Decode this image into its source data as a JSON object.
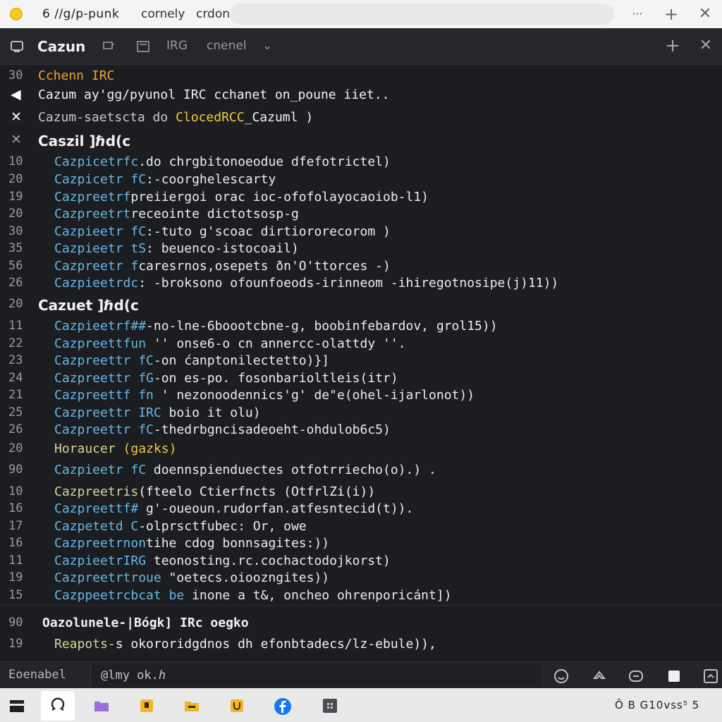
{
  "titlebar": {
    "title": "6 //g/p-punk",
    "tab1": "cornely",
    "tab2": "crdon",
    "more": "···",
    "plus": "+",
    "close": "✕"
  },
  "channel": {
    "title": "Cazun",
    "tab_label": "IRG",
    "tab_label2": "cnenel",
    "chevron": "⌄",
    "plus": "+",
    "close": "✕"
  },
  "log": {
    "rows": [
      {
        "num": "30",
        "text": "Cchenn IRC"
      },
      {
        "icon": "◀",
        "text": "Cazum ay'gg/pyunol IRC cchanet on_poune iiet.."
      },
      {
        "icon": "✕",
        "text_a": "Cazum-saetscta do ",
        "text_b": "ClocedRCC",
        "text_c": "_Cazuml )"
      },
      {
        "icon": "✕",
        "text": "Caszil ]ℏd(c"
      },
      {
        "num": "10",
        "nick": "Cazpicetrfc",
        "msg": ".do chrgbitonoeodue dfefotrictel)"
      },
      {
        "num": "20",
        "nick": "Cazpicetr fC",
        "msg": ":-coorghelescarty"
      },
      {
        "num": "19",
        "nick": "Cazpreetrf",
        "msg": "preiiergoi orac ioc-ofofolayocaoiob-l1)"
      },
      {
        "num": "20",
        "nick": "Cazpreetrt",
        "msg": "receointe dictotsosp-g"
      },
      {
        "num": "30",
        "nick": "Cazpieetr fC",
        "msg": ":-tuto g'scoac dirtiororecorom  )"
      },
      {
        "num": "35",
        "nick": "Cazpieetr tS",
        "msg": ": beuenco-istocoail)"
      },
      {
        "num": "56",
        "nick": "Cazpreetr f",
        "msg": "caresrnos,osepets ðn'O'ttorces -)"
      },
      {
        "num": "26",
        "nick": "Cazpieetrdc",
        "msg": ": -broksono ofounfoeods-irinneom -ihiregotnosipe(j)11))"
      },
      {
        "num": "20",
        "text": "Cazuet ]ℏd(c"
      },
      {
        "num": "11",
        "nick": "Cazpieetrf##",
        "msg": "-no-lne-6boootcbne-g, boobinfebardov, grol15))"
      },
      {
        "num": "22",
        "nick": "Cazpreettfun",
        "msg": " '' onse6-o cn annercc-olattdy  ''."
      },
      {
        "num": "23",
        "nick": "Cazpreettr fC",
        "msg": "-on ćanptonilectetto)}]"
      },
      {
        "num": "24",
        "nick": "Cazpreettr fG",
        "msg": "-on es-po. fosonbarioltleis(itr)"
      },
      {
        "num": "21",
        "nick": "Cazpreettf fn",
        "msg": " ' nezonoodennics'g' de\"e(ohel-ijarlonot))"
      },
      {
        "num": "25",
        "nick": "Cazpreettr IRC",
        "msg": " boio it olu)"
      },
      {
        "num": "26",
        "nick": "Cazpreettr fC",
        "msg": "-thedrbgncisadeoeht-ohdulob6c5)"
      },
      {
        "num": "20",
        "text_a": "Horаucer ",
        "text_b": "(gazks)"
      },
      {
        "num": "90",
        "nick": "Cazpieetr fC",
        "msg": " doennspienduectes otfotrriecho(o).)  ."
      },
      {
        "num": "10",
        "text_a": "Cazpreetris",
        "text_b": "(fteelo Ctierfncts (OtfrlZi(i))"
      },
      {
        "num": "16",
        "nick": "Cazpreettf#",
        "msg": " g'-oueoun.rudorfan.atfesntecid(t))."
      },
      {
        "num": "17",
        "nick": "Cazpetetd C",
        "msg": "-olprsctfubec: Or, owe"
      },
      {
        "num": "16",
        "nick": "Cazpreetrnon",
        "msg": "tihe cdog bonnsagites:))"
      },
      {
        "num": "11",
        "nick": "CazpieetrIRG",
        "msg": " teonosting.rc.cochactodojkorst)"
      },
      {
        "num": "19",
        "nick": "Cazpreetrtroue",
        "msg": " \"oetecs.oioozngites))"
      },
      {
        "num": "15",
        "nick": "Cazppeetrcbcat be",
        "msg": " inone a t&, oncheo ohrenporicánt])"
      },
      {
        "num": "90",
        "text_a": "Oazolunele",
        "text_b": "-|Bógk] IRc oegko"
      },
      {
        "num": "19",
        "text_a": "Reapots-",
        "text_b": "s okororidgdnos dh efonbtadecs/lz-ebule)),"
      }
    ]
  },
  "input": {
    "nick": "Eoenabel",
    "value": "@lmy ok.ℎ"
  },
  "taskbar": {
    "tray": "Ô B G10vss⁵ 5"
  },
  "colors": {
    "background": "#1b1d20",
    "nick": "#66b7e9",
    "highlight_orange": "#f0a135",
    "highlight_yellow": "#f1c94a",
    "taskbar": "#e9e9ea"
  }
}
